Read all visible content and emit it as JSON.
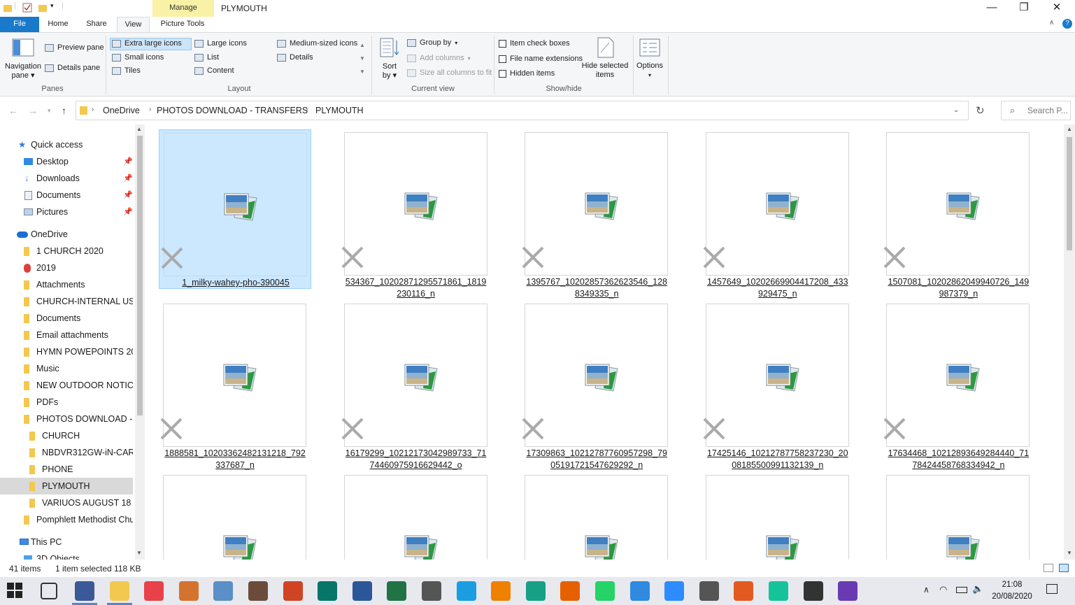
{
  "window": {
    "title": "PLYMOUTH",
    "manage_tab": "Manage",
    "minimize": "—",
    "restore": "❐",
    "close": "✕"
  },
  "ribbon_tabs": [
    {
      "label": "File"
    },
    {
      "label": "Home"
    },
    {
      "label": "Share"
    },
    {
      "label": "View"
    },
    {
      "label": "Picture Tools"
    }
  ],
  "ribbon": {
    "panes": {
      "navigation_pane": "Navigation",
      "navigation_pane_2": "pane",
      "preview_pane": "Preview pane",
      "details_pane": "Details pane",
      "group_label": "Panes"
    },
    "layout": {
      "items": [
        "Extra large icons",
        "Large icons",
        "Medium-sized icons",
        "Small icons",
        "List",
        "Details",
        "Tiles",
        "Content"
      ],
      "selected": "Extra large icons",
      "group_label": "Layout"
    },
    "current_view": {
      "sort_by": "Sort",
      "sort_by_2": "by",
      "group_by": "Group by",
      "add_columns": "Add columns",
      "size_columns": "Size all columns to fit",
      "group_label": "Current view"
    },
    "show_hide": {
      "item_check_boxes": "Item check boxes",
      "file_name_extensions": "File name extensions",
      "hidden_items": "Hidden items",
      "hide_selected": "Hide selected",
      "hide_selected_2": "items",
      "group_label": "Show/hide"
    },
    "options": "Options"
  },
  "address": {
    "crumbs": [
      "OneDrive",
      "PHOTOS DOWNLOAD  - TRANSFERS",
      "PLYMOUTH"
    ],
    "search_placeholder": "Search P..."
  },
  "sidebar": {
    "quick_access": "Quick access",
    "quick_items": [
      {
        "label": "Desktop",
        "icon": "desktop-icon"
      },
      {
        "label": "Downloads",
        "icon": "download-icon"
      },
      {
        "label": "Documents",
        "icon": "document-icon"
      },
      {
        "label": "Pictures",
        "icon": "pictures-icon"
      }
    ],
    "onedrive": "OneDrive",
    "onedrive_items": [
      "1 CHURCH 2020",
      "2019",
      "Attachments",
      "CHURCH-INTERNAL USE",
      "Documents",
      "Email attachments",
      "HYMN POWEPOINTS 20",
      "Music",
      "NEW OUTDOOR NOTICE",
      "PDFs",
      "PHOTOS DOWNLOAD  - T"
    ],
    "sub_items": [
      "CHURCH",
      "NBDVR312GW-iN-CAR",
      "PHONE",
      "PLYMOUTH",
      "VARIUOS AUGUST 18"
    ],
    "after_items": [
      "Pomphlett Methodist Chu"
    ],
    "this_pc": "This PC",
    "objects_3d": "3D Objects"
  },
  "files": [
    "1_milky-wahey-pho-390045",
    "534367_10202871295571861_1819230116_n",
    "1395767_10202857362623546_1288349335_n",
    "1457649_10202669904417208_433929475_n",
    "1507081_10202862049940726_149987379_n",
    "1888581_10203362482131218_792337687_n",
    "16179299_10212173042989733_7174460975916629442_o",
    "17309863_10212787760957298_7905191721547629292_n",
    "17425146_10212787758237230_2008185500991132139_n",
    "17634468_10212893649284440_7178424458768334942_n",
    "",
    "",
    "",
    "",
    ""
  ],
  "file_lines": [
    [
      "1_milky-wahey-pho-390045",
      ""
    ],
    [
      "534367_10202871295571861_1819",
      "230116_n"
    ],
    [
      "1395767_10202857362623546_128",
      "8349335_n"
    ],
    [
      "1457649_10202669904417208_433",
      "929475_n"
    ],
    [
      "1507081_10202862049940726_149",
      "987379_n"
    ],
    [
      "1888581_10203362482131218_792",
      "337687_n"
    ],
    [
      "16179299_10212173042989733_71",
      "74460975916629442_o"
    ],
    [
      "17309863_10212787760957298_79",
      "05191721547629292_n"
    ],
    [
      "17425146_10212787758237230_20",
      "08185500991132139_n"
    ],
    [
      "17634468_10212893649284440_71",
      "78424458768334942_n"
    ]
  ],
  "status": {
    "count": "41 items",
    "selected": "1 item selected  118 KB"
  },
  "taskbar": {
    "time": "21:08",
    "date": "20/08/2020",
    "apps": [
      "start-icon",
      "task-view-icon",
      "calculator-icon",
      "file-explorer-icon",
      "app-calendar-icon",
      "camera-settings-icon",
      "control-panel-icon",
      "kindle-icon",
      "powerpoint-icon",
      "publisher-icon",
      "word-icon",
      "excel-icon",
      "notepad-icon",
      "edge-icon",
      "vlc-icon",
      "shield-icon",
      "firefox-icon",
      "whatsapp-icon",
      "phone-app-icon",
      "zoom-icon",
      "camera-icon",
      "onenote-icon",
      "grammarly-icon",
      "app-icon",
      "pen-icon"
    ]
  },
  "colors": {
    "accent": "#1979ca",
    "selection": "#cce8ff",
    "manage_tab": "#f9f1a6",
    "folder": "#f3c84e"
  }
}
